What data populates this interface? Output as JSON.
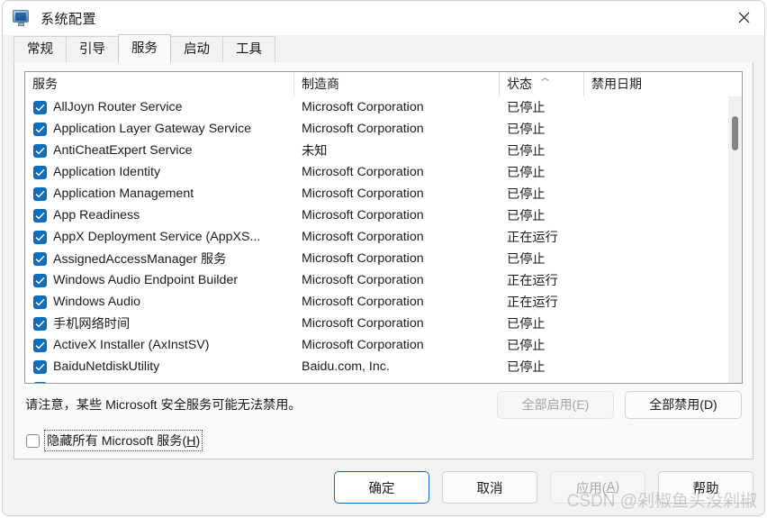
{
  "window": {
    "title": "系统配置",
    "icon": "computer-monitor-icon",
    "close_label": "✕"
  },
  "tabs": [
    {
      "label": "常规",
      "active": false
    },
    {
      "label": "引导",
      "active": false
    },
    {
      "label": "服务",
      "active": true
    },
    {
      "label": "启动",
      "active": false
    },
    {
      "label": "工具",
      "active": false
    }
  ],
  "list": {
    "columns": [
      {
        "key": "service",
        "label": "服务",
        "sort": ""
      },
      {
        "key": "vendor",
        "label": "制造商",
        "sort": ""
      },
      {
        "key": "state",
        "label": "状态",
        "sort": "asc"
      },
      {
        "key": "date",
        "label": "禁用日期",
        "sort": ""
      }
    ],
    "rows": [
      {
        "checked": true,
        "service": "AllJoyn Router Service",
        "vendor": "Microsoft Corporation",
        "state": "已停止",
        "date": ""
      },
      {
        "checked": true,
        "service": "Application Layer Gateway Service",
        "vendor": "Microsoft Corporation",
        "state": "已停止",
        "date": ""
      },
      {
        "checked": true,
        "service": "AntiCheatExpert Service",
        "vendor": "未知",
        "state": "已停止",
        "date": ""
      },
      {
        "checked": true,
        "service": "Application Identity",
        "vendor": "Microsoft Corporation",
        "state": "已停止",
        "date": ""
      },
      {
        "checked": true,
        "service": "Application Management",
        "vendor": "Microsoft Corporation",
        "state": "已停止",
        "date": ""
      },
      {
        "checked": true,
        "service": "App Readiness",
        "vendor": "Microsoft Corporation",
        "state": "已停止",
        "date": ""
      },
      {
        "checked": true,
        "service": "AppX Deployment Service (AppXS...",
        "vendor": "Microsoft Corporation",
        "state": "正在运行",
        "date": ""
      },
      {
        "checked": true,
        "service": "AssignedAccessManager 服务",
        "vendor": "Microsoft Corporation",
        "state": "已停止",
        "date": ""
      },
      {
        "checked": true,
        "service": "Windows Audio Endpoint Builder",
        "vendor": "Microsoft Corporation",
        "state": "正在运行",
        "date": ""
      },
      {
        "checked": true,
        "service": "Windows Audio",
        "vendor": "Microsoft Corporation",
        "state": "正在运行",
        "date": ""
      },
      {
        "checked": true,
        "service": "手机网络时间",
        "vendor": "Microsoft Corporation",
        "state": "已停止",
        "date": ""
      },
      {
        "checked": true,
        "service": "ActiveX Installer (AxInstSV)",
        "vendor": "Microsoft Corporation",
        "state": "已停止",
        "date": ""
      },
      {
        "checked": true,
        "service": "BaiduNetdiskUtility",
        "vendor": "Baidu.com, Inc.",
        "state": "已停止",
        "date": ""
      },
      {
        "checked": true,
        "service": "",
        "vendor": "",
        "state": "",
        "date": ""
      }
    ],
    "scroll_position": "near-top"
  },
  "note": "请注意，某些 Microsoft 安全服务可能无法禁用。",
  "actions": {
    "enable_all": "全部启用(E)",
    "enable_all_accel": "E",
    "enable_all_disabled": true,
    "disable_all": "全部禁用(D)",
    "disable_all_accel": "D",
    "disable_all_disabled": false
  },
  "hide_microsoft": {
    "label_prefix": "隐藏所有 Microsoft 服务(",
    "accel": "H",
    "label_suffix": ")",
    "checked": false,
    "focused": true
  },
  "footer": {
    "ok": "确定",
    "cancel": "取消",
    "apply_prefix": "应用(",
    "apply_accel": "A",
    "apply_suffix": ")",
    "apply_disabled": true,
    "help": "帮助"
  },
  "watermark": "CSDN @剁椒鱼头没剁椒",
  "colors": {
    "accent": "#0f6cbd",
    "window_bg": "#f3f3f3",
    "page_bg": "#fafafa",
    "text": "#1a1a1a",
    "disabled_text": "#a4a4a4"
  }
}
